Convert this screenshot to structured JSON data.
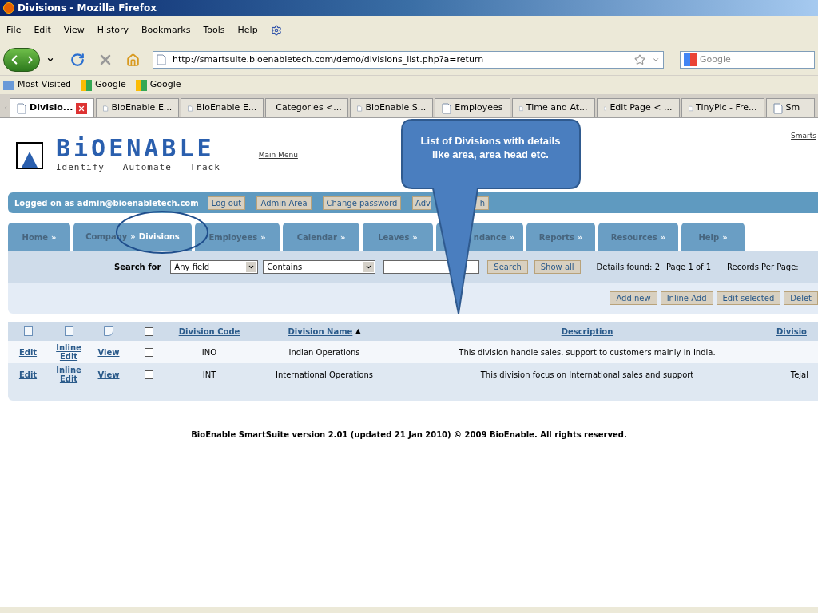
{
  "window": {
    "title": "Divisions - Mozilla Firefox"
  },
  "menu": [
    "File",
    "Edit",
    "View",
    "History",
    "Bookmarks",
    "Tools",
    "Help"
  ],
  "address": {
    "url": "http://smartsuite.bioenabletech.com/demo/divisions_list.php?a=return"
  },
  "web_search": {
    "placeholder": "Google"
  },
  "bookmarks": [
    "Most Visited",
    "Google",
    "Google"
  ],
  "browser_tabs": [
    {
      "label": "Divisio...",
      "selected": true
    },
    {
      "label": "BioEnable E...",
      "selected": false
    },
    {
      "label": "BioEnable E...",
      "selected": false
    },
    {
      "label": "Categories <...",
      "selected": false
    },
    {
      "label": "BioEnable S...",
      "selected": false
    },
    {
      "label": "Employees",
      "selected": false
    },
    {
      "label": "Time and At...",
      "selected": false
    },
    {
      "label": "Edit Page < ...",
      "selected": false
    },
    {
      "label": "TinyPic - Fre...",
      "selected": false
    },
    {
      "label": "Sm",
      "selected": false
    }
  ],
  "header": {
    "logo": "BiOENABLE",
    "tagline": "Identify - Automate - Track",
    "main_menu": "Main Menu",
    "top_right_link": "Smarts"
  },
  "user_bar": {
    "text": "Logged on as admin@bioenabletech.com",
    "buttons": [
      {
        "label": "Log out"
      },
      {
        "label": "Admin Area"
      },
      {
        "label": "Change password"
      },
      {
        "label": "Adv",
        "label_end": "h"
      }
    ]
  },
  "nav_tabs": [
    {
      "label": "Home",
      "selected": false
    },
    {
      "label": "Company",
      "sub": "Divisions",
      "selected": true
    },
    {
      "label": "Employees",
      "selected": false
    },
    {
      "label": "Calendar",
      "selected": false
    },
    {
      "label": "Leaves",
      "selected": false
    },
    {
      "label": "ndance",
      "selected": false
    },
    {
      "label": "Reports",
      "selected": false
    },
    {
      "label": "Resources",
      "selected": false
    },
    {
      "label": "Help",
      "selected": false
    }
  ],
  "nav_separator": "»",
  "search": {
    "label": "Search for",
    "field": "Any field",
    "operator": "Contains",
    "buttons": [
      "Search",
      "Show all"
    ],
    "details": "Details found: 2",
    "page": "Page 1 of 1",
    "per_page": "Records Per Page:"
  },
  "actions": [
    "Add new",
    "Inline Add",
    "Edit selected",
    "Delet"
  ],
  "table": {
    "columns": [
      "Division Code",
      "Division Name",
      "Description",
      "Divisio"
    ],
    "sort_mark": "▲",
    "all_checked": false,
    "rows": [
      {
        "edit": "Edit",
        "inline_edit": "Inline Edit",
        "view": "View",
        "checked": false,
        "code": "INO",
        "name": "Indian Operations",
        "description": "This division handle sales, support to customers mainly in India."
      },
      {
        "edit": "Edit",
        "inline_edit": "Inline Edit",
        "view": "View",
        "checked": false,
        "code": "INT",
        "name": "International Operations",
        "description": "This division focus on International sales and support",
        "column_4": "Tejal"
      }
    ]
  },
  "footer": "BioEnable SmartSuite version 2.01 (updated 21 Jan 2010) © 2009 BioEnable. All rights reserved.",
  "callout": "List of Divisions with details like area, area head etc."
}
